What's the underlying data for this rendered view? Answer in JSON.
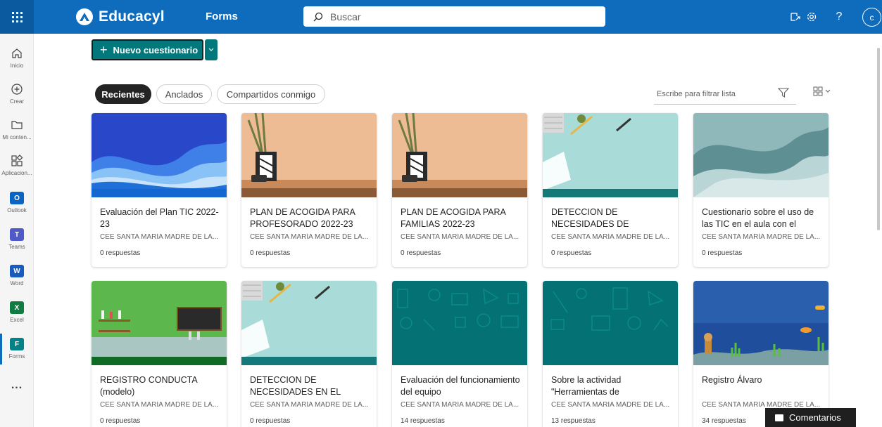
{
  "header": {
    "brand": "Educacyl",
    "app": "Forms",
    "search_placeholder": "Buscar",
    "avatar_initial": "c",
    "help_label": "?"
  },
  "rail": {
    "inicio": "Inicio",
    "crear": "Crear",
    "contenido": "Mi conten...",
    "aplicaciones": "Aplicacion...",
    "outlook": "Outlook",
    "teams": "Teams",
    "word": "Word",
    "excel": "Excel",
    "forms": "Forms",
    "more": "..."
  },
  "toolbar": {
    "new_label": "Nuevo cuestionario",
    "tabs": [
      "Recientes",
      "Anclados",
      "Compartidos conmigo"
    ],
    "filter_placeholder": "Escribe para filtrar lista"
  },
  "cards": [
    {
      "title": "Evaluación del Plan TIC 2022-23",
      "org": "CEE SANTA MARÍA MADRE DE LA...",
      "responses": "0 respuestas",
      "theme": "wave-blue"
    },
    {
      "title": "PLAN DE ACOGIDA PARA PROFESORADO 2022-23",
      "org": "CEE SANTA MARÍA MADRE DE LA...",
      "responses": "0 respuestas",
      "theme": "desk-peach"
    },
    {
      "title": "PLAN DE ACOGIDA PARA FAMILIAS 2022-23",
      "org": "CEE SANTA MARÍA MADRE DE LA...",
      "responses": "0 respuestas",
      "theme": "desk-peach"
    },
    {
      "title": "DETECCION DE NECESIDADES DE",
      "org": "CEE SANTA MARÍA MADRE DE LA...",
      "responses": "0 respuestas",
      "theme": "desk-mint"
    },
    {
      "title": "Cuestionario sobre el uso de las TIC en el aula con el",
      "org": "CEE SANTA MARÍA MADRE DE LA...",
      "responses": "0 respuestas",
      "theme": "wave-teal"
    },
    {
      "title": "REGISTRO CONDUCTA (modelo)",
      "org": "CEE SANTA MARÍA MADRE DE LA...",
      "responses": "0 respuestas",
      "theme": "lab-green"
    },
    {
      "title": "DETECCION DE NECESIDADES EN EL",
      "org": "CEE SANTA MARÍA MADRE DE LA...",
      "responses": "0 respuestas",
      "theme": "desk-mint"
    },
    {
      "title": "Evaluación del funcionamiento del equipo",
      "org": "CEE SANTA MARÍA MADRE DE LA...",
      "responses": "14 respuestas",
      "theme": "teal-pattern"
    },
    {
      "title": "Sobre la actividad \"Herramientas de",
      "org": "CEE SANTA MARÍA MADRE DE LA...",
      "responses": "13 respuestas",
      "theme": "teal-pattern"
    },
    {
      "title": "Registro Álvaro",
      "org": "CEE SANTA MARÍA MADRE DE LA...",
      "responses": "34 respuestas",
      "theme": "ocean"
    }
  ],
  "feedback_label": "Comentarios",
  "colors": {
    "header": "#0f6cbd",
    "accent": "#03787c",
    "teal_card": "#047274"
  }
}
